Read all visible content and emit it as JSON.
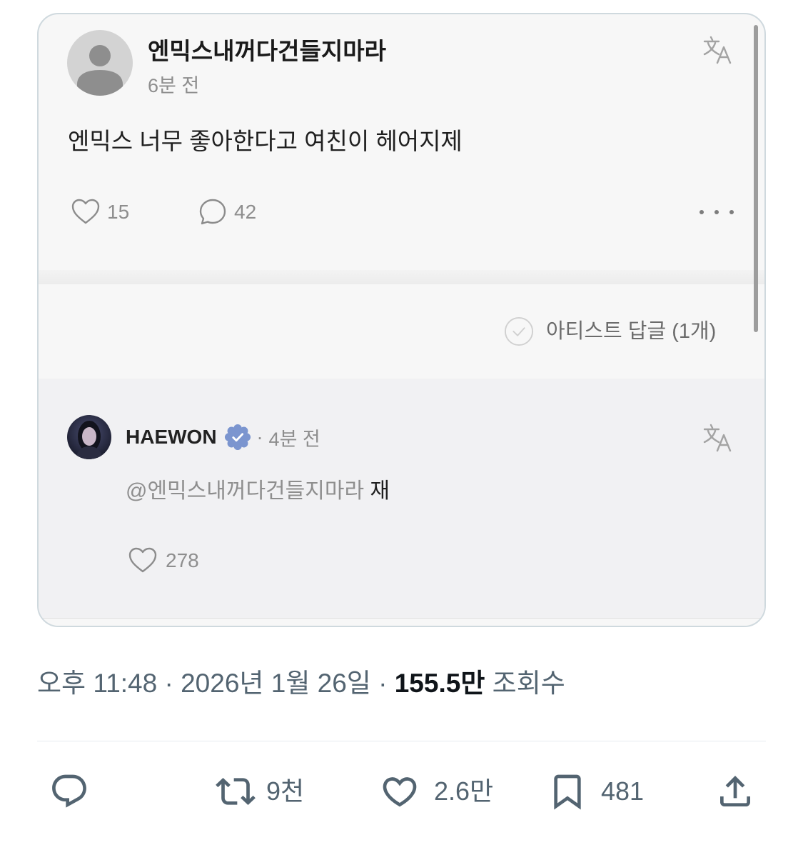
{
  "embedded_post": {
    "author": "엔믹스내꺼다건들지마라",
    "time": "6분 전",
    "text": "엔믹스 너무 좋아한다고 여친이 헤어지제",
    "likes": "15",
    "comments": "42",
    "artist_reply_label": "아티스트 답글 (1개)"
  },
  "artist_reply": {
    "name": "HAEWON",
    "verified": true,
    "separator": "·",
    "time": "4분 전",
    "mention": "@엔믹스내꺼다건들지마라",
    "text": "재",
    "likes": "278"
  },
  "tweet_meta": {
    "time": "오후 11:48",
    "separator": "·",
    "date": "2026년 1월 26일",
    "views_count": "155.5만",
    "views_label": "조회수"
  },
  "actions": {
    "reply": {
      "icon": "reply-icon"
    },
    "retweet": {
      "icon": "retweet-icon",
      "count": "9천"
    },
    "like": {
      "icon": "heart-icon",
      "count": "2.6만"
    },
    "bookmark": {
      "icon": "bookmark-icon",
      "count": "481"
    },
    "share": {
      "icon": "share-icon"
    }
  },
  "icons": {
    "fan_avatar": "default-avatar-icon",
    "translate": "translate-icon",
    "post_like": "heart-outline-icon",
    "post_comment": "comment-bubble-icon",
    "more": "more-dots-icon",
    "artist_reply_toggle": "check-circle-icon",
    "verified": "verified-badge-icon"
  },
  "colors": {
    "text_primary": "#0f1419",
    "text_secondary": "#536471",
    "card_border": "#cfd9de",
    "embed_background": "#f7f7f7",
    "reply_background": "#f1f1f3",
    "verified_badge": "#7b95cf"
  }
}
